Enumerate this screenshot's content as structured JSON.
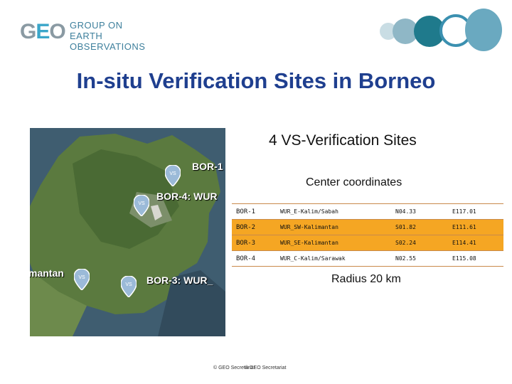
{
  "header": {
    "logo_mark": "GEO",
    "logo_line1": "GROUP ON",
    "logo_line2": "EARTH OBSERVATIONS",
    "title": "In-situ Verification Sites in Borneo"
  },
  "map": {
    "labels": [
      "BOR-1",
      "BOR-4: WUR",
      "mantan",
      "BOR-3: WUR_"
    ],
    "pin_text": "VS"
  },
  "subtitle": "4 VS-Verification Sites",
  "center_coordinates_label": "Center coordinates",
  "table": {
    "rows": [
      {
        "id": "BOR-1",
        "name": "WUR_E-Kalim/Sabah",
        "lat": "N04.33",
        "lon": "E117.01",
        "highlight": false
      },
      {
        "id": "BOR-2",
        "name": "WUR_SW-Kalimantan",
        "lat": "S01.82",
        "lon": "E111.61",
        "highlight": true
      },
      {
        "id": "BOR-3",
        "name": "WUR_SE-Kalimantan",
        "lat": "S02.24",
        "lon": "E114.41",
        "highlight": true
      },
      {
        "id": "BOR-4",
        "name": "WUR_C-Kalim/Sarawak",
        "lat": "N02.55",
        "lon": "E115.08",
        "highlight": false
      }
    ]
  },
  "radius": "Radius 20 km",
  "footer": {
    "text1": "© GEO Secretariat",
    "text2": "© GEO Secretariat"
  },
  "colors": {
    "title": "#1f3f8f",
    "highlight_row": "#f5a623",
    "logo_accent": "#3aa6c9"
  }
}
